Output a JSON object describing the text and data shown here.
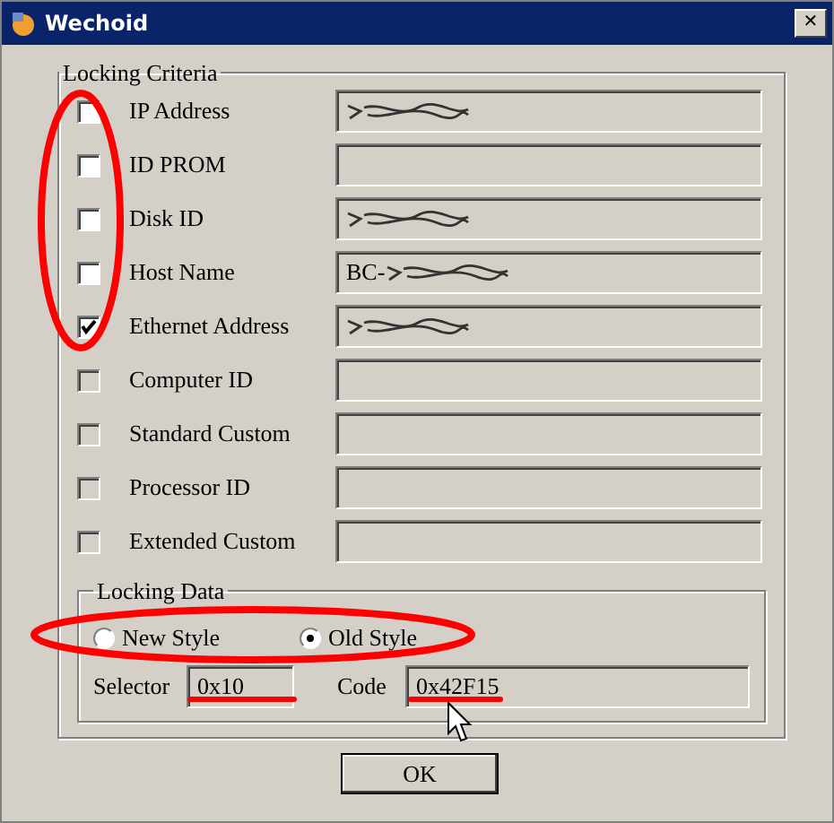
{
  "window": {
    "title": "Wechoid",
    "close": "✕"
  },
  "criteria": {
    "title": "Locking Criteria",
    "items": [
      {
        "label": "IP Address",
        "checked": false,
        "disabled": false,
        "value": "",
        "redacted": true
      },
      {
        "label": "ID PROM",
        "checked": false,
        "disabled": false,
        "value": "",
        "redacted": false
      },
      {
        "label": "Disk ID",
        "checked": false,
        "disabled": false,
        "value": "",
        "redacted": true
      },
      {
        "label": "Host Name",
        "checked": false,
        "disabled": false,
        "value": "BC-",
        "redacted": true
      },
      {
        "label": "Ethernet Address",
        "checked": true,
        "disabled": false,
        "value": "",
        "redacted": true
      },
      {
        "label": "Computer ID",
        "checked": false,
        "disabled": true,
        "value": "",
        "redacted": false
      },
      {
        "label": "Standard Custom",
        "checked": false,
        "disabled": true,
        "value": "",
        "redacted": false
      },
      {
        "label": "Processor ID",
        "checked": false,
        "disabled": true,
        "value": "",
        "redacted": false
      },
      {
        "label": "Extended Custom",
        "checked": false,
        "disabled": true,
        "value": "",
        "redacted": false
      }
    ]
  },
  "locking_data": {
    "title": "Locking Data",
    "styles": [
      {
        "label": "New Style",
        "selected": false
      },
      {
        "label": "Old Style",
        "selected": true
      }
    ],
    "selector": {
      "label": "Selector",
      "value": "0x10"
    },
    "code": {
      "label": "Code",
      "value": "0x42F15"
    }
  },
  "buttons": [
    "OK"
  ]
}
